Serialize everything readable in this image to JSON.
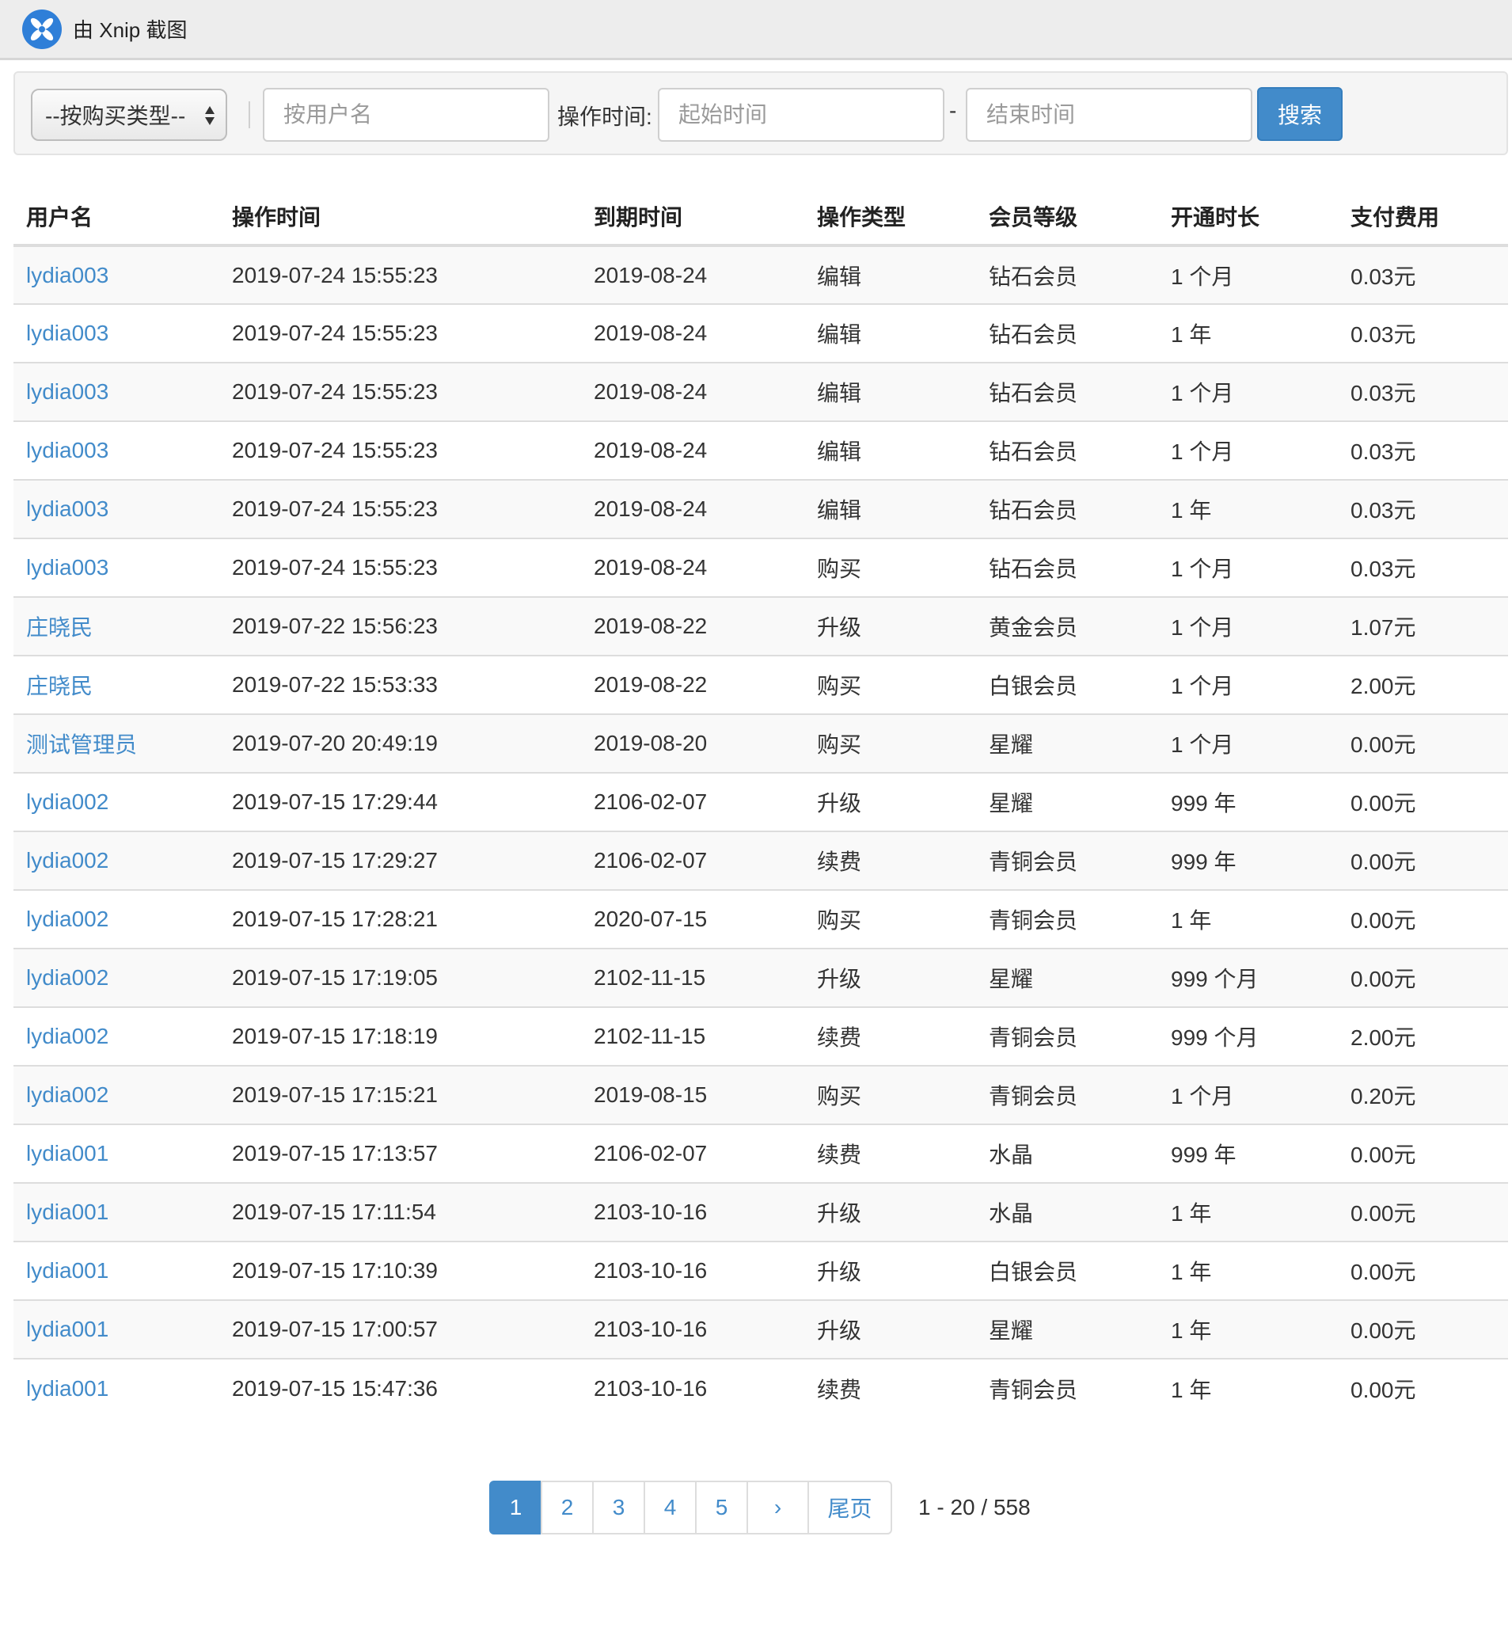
{
  "window": {
    "title": "由 Xnip 截图"
  },
  "filters": {
    "type_select": "--按购买类型--",
    "username_placeholder": "按用户名",
    "optime_label": "操作时间:",
    "start_placeholder": "起始时间",
    "range_separator": "-",
    "end_placeholder": "结束时间",
    "search_label": "搜索"
  },
  "table": {
    "headers": [
      "用户名",
      "操作时间",
      "到期时间",
      "操作类型",
      "会员等级",
      "开通时长",
      "支付费用"
    ],
    "rows": [
      [
        "lydia003",
        "2019-07-24 15:55:23",
        "2019-08-24",
        "编辑",
        "钻石会员",
        "1 个月",
        "0.03元"
      ],
      [
        "lydia003",
        "2019-07-24 15:55:23",
        "2019-08-24",
        "编辑",
        "钻石会员",
        "1 年",
        "0.03元"
      ],
      [
        "lydia003",
        "2019-07-24 15:55:23",
        "2019-08-24",
        "编辑",
        "钻石会员",
        "1 个月",
        "0.03元"
      ],
      [
        "lydia003",
        "2019-07-24 15:55:23",
        "2019-08-24",
        "编辑",
        "钻石会员",
        "1 个月",
        "0.03元"
      ],
      [
        "lydia003",
        "2019-07-24 15:55:23",
        "2019-08-24",
        "编辑",
        "钻石会员",
        "1 年",
        "0.03元"
      ],
      [
        "lydia003",
        "2019-07-24 15:55:23",
        "2019-08-24",
        "购买",
        "钻石会员",
        "1 个月",
        "0.03元"
      ],
      [
        "庄晓民",
        "2019-07-22 15:56:23",
        "2019-08-22",
        "升级",
        "黄金会员",
        "1 个月",
        "1.07元"
      ],
      [
        "庄晓民",
        "2019-07-22 15:53:33",
        "2019-08-22",
        "购买",
        "白银会员",
        "1 个月",
        "2.00元"
      ],
      [
        "测试管理员",
        "2019-07-20 20:49:19",
        "2019-08-20",
        "购买",
        "星耀",
        "1 个月",
        "0.00元"
      ],
      [
        "lydia002",
        "2019-07-15 17:29:44",
        "2106-02-07",
        "升级",
        "星耀",
        "999 年",
        "0.00元"
      ],
      [
        "lydia002",
        "2019-07-15 17:29:27",
        "2106-02-07",
        "续费",
        "青铜会员",
        "999 年",
        "0.00元"
      ],
      [
        "lydia002",
        "2019-07-15 17:28:21",
        "2020-07-15",
        "购买",
        "青铜会员",
        "1 年",
        "0.00元"
      ],
      [
        "lydia002",
        "2019-07-15 17:19:05",
        "2102-11-15",
        "升级",
        "星耀",
        "999 个月",
        "0.00元"
      ],
      [
        "lydia002",
        "2019-07-15 17:18:19",
        "2102-11-15",
        "续费",
        "青铜会员",
        "999 个月",
        "2.00元"
      ],
      [
        "lydia002",
        "2019-07-15 17:15:21",
        "2019-08-15",
        "购买",
        "青铜会员",
        "1 个月",
        "0.20元"
      ],
      [
        "lydia001",
        "2019-07-15 17:13:57",
        "2106-02-07",
        "续费",
        "水晶",
        "999 年",
        "0.00元"
      ],
      [
        "lydia001",
        "2019-07-15 17:11:54",
        "2103-10-16",
        "升级",
        "水晶",
        "1 年",
        "0.00元"
      ],
      [
        "lydia001",
        "2019-07-15 17:10:39",
        "2103-10-16",
        "升级",
        "白银会员",
        "1 年",
        "0.00元"
      ],
      [
        "lydia001",
        "2019-07-15 17:00:57",
        "2103-10-16",
        "升级",
        "星耀",
        "1 年",
        "0.00元"
      ],
      [
        "lydia001",
        "2019-07-15 15:47:36",
        "2103-10-16",
        "续费",
        "青铜会员",
        "1 年",
        "0.00元"
      ]
    ]
  },
  "pagination": {
    "pages": [
      "1",
      "2",
      "3",
      "4",
      "5"
    ],
    "current_page": "1",
    "next": "›",
    "last": "尾页",
    "summary": "1 - 20 / 558"
  },
  "colors": {
    "link": "#428bca",
    "primary_button": "#428bca",
    "logo": "#2f7fd8"
  },
  "icons": {
    "logo": "xnip-logo-icon",
    "select_arrows": "updown-arrows-icon"
  }
}
